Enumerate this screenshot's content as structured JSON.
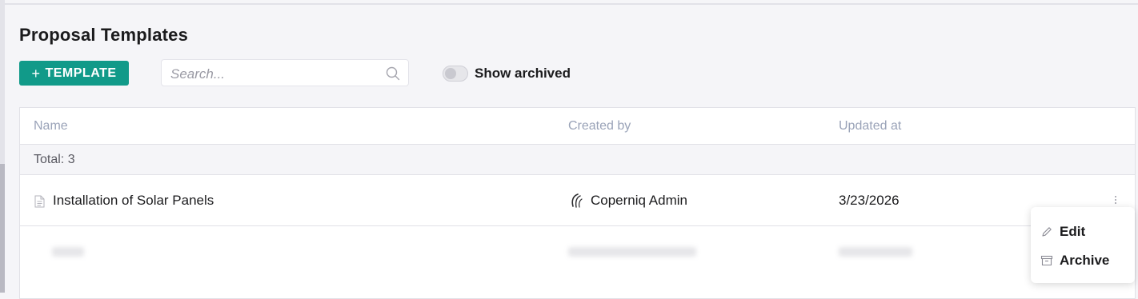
{
  "page": {
    "title": "Proposal Templates"
  },
  "toolbar": {
    "add_button_plus": "+",
    "add_button_label": "TEMPLATE",
    "search_placeholder": "Search...",
    "search_icon": "search-icon",
    "show_archived_label": "Show archived",
    "show_archived_on": false
  },
  "table": {
    "columns": [
      "Name",
      "Created by",
      "Updated at"
    ],
    "total_label": "Total: 3",
    "rows": [
      {
        "name": "Installation of Solar Panels",
        "name_icon": "document-icon",
        "created_by": "Coperniq Admin",
        "created_by_icon": "coperniq-logo-icon",
        "updated_at": "3/23/2026"
      }
    ]
  },
  "context_menu": {
    "items": [
      {
        "label": "Edit",
        "icon": "pencil-icon"
      },
      {
        "label": "Archive",
        "icon": "archive-box-icon"
      }
    ]
  },
  "colors": {
    "accent": "#119a89",
    "header_text": "#9aa3b8",
    "background": "#f5f5f8"
  }
}
